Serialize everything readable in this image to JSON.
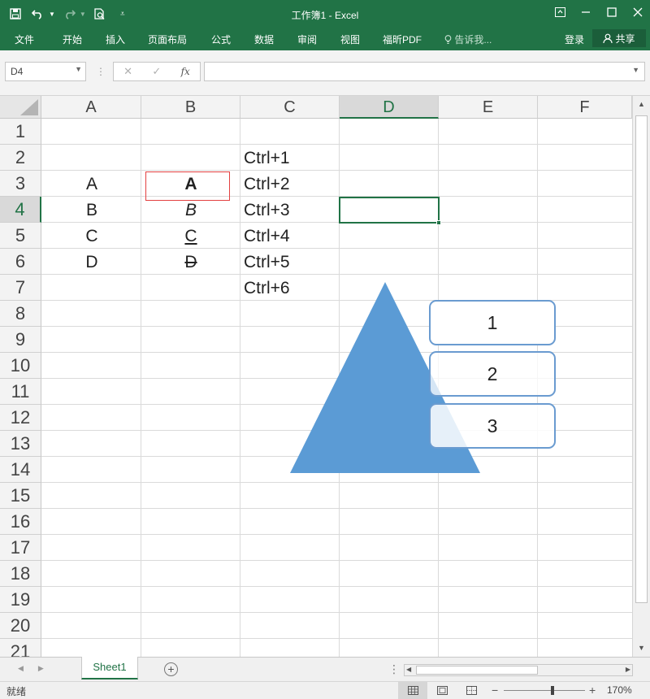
{
  "window": {
    "title": "工作簿1 - Excel"
  },
  "ribbon": {
    "tabs": [
      "文件",
      "开始",
      "插入",
      "页面布局",
      "公式",
      "数据",
      "审阅",
      "视图",
      "福昕PDF"
    ],
    "tell_me": "告诉我...",
    "login": "登录",
    "share": "共享"
  },
  "formula_bar": {
    "name_box": "D4",
    "formula": ""
  },
  "sheet": {
    "columns": [
      "A",
      "B",
      "C",
      "D",
      "E",
      "F"
    ],
    "rows": [
      "1",
      "2",
      "3",
      "4",
      "5",
      "6",
      "7",
      "8",
      "9",
      "10",
      "11",
      "12",
      "13",
      "14",
      "15",
      "16",
      "17",
      "18",
      "19",
      "20",
      "21"
    ],
    "selected_column": "D",
    "selected_row": "4",
    "cells": {
      "A3": "A",
      "A4": "B",
      "A5": "C",
      "A6": "D",
      "B3": "A",
      "B4": "B",
      "B5": "C",
      "B6": "D",
      "C2": "Ctrl+1",
      "C3": "Ctrl+2",
      "C4": "Ctrl+3",
      "C5": "Ctrl+4",
      "C6": "Ctrl+5",
      "C7": "Ctrl+6"
    }
  },
  "shapes": {
    "triangle_color": "#5b9bd5",
    "box_border_color": "#6a9bd0",
    "boxes": [
      "1",
      "2",
      "3"
    ]
  },
  "tabs": {
    "sheets": [
      "Sheet1"
    ],
    "active": "Sheet1"
  },
  "status": {
    "text": "就绪",
    "zoom": "170%",
    "zoom_fraction": 0.6
  },
  "colors": {
    "brand": "#217346"
  }
}
